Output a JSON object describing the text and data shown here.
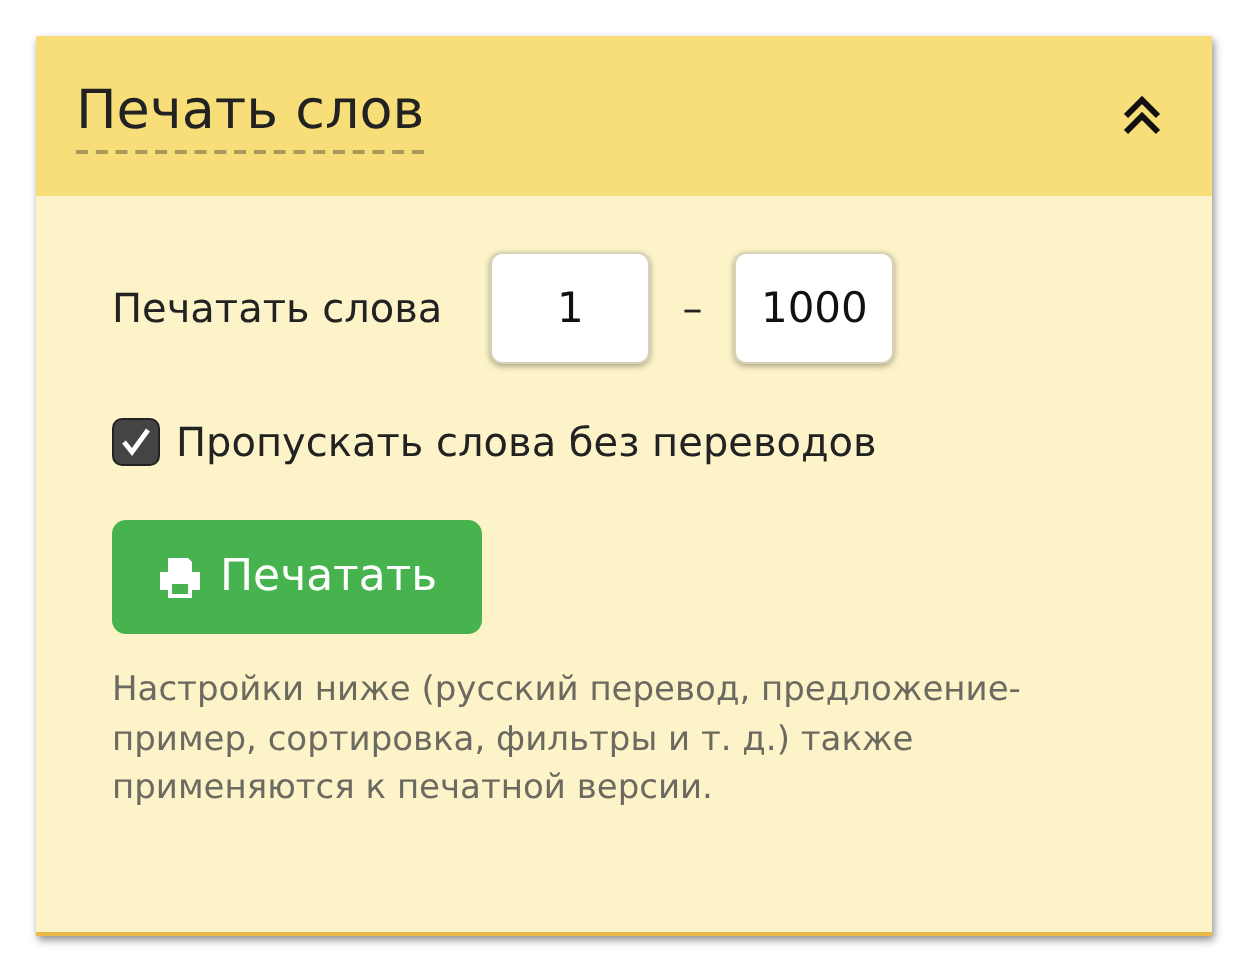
{
  "panel": {
    "title": "Печать слов",
    "expanded": true,
    "range": {
      "label": "Печатать слова",
      "from": "1",
      "separator": "–",
      "to": "1000"
    },
    "skip_untranslated": {
      "label": "Пропускать слова без переводов",
      "checked": true
    },
    "print_button": "Печатать",
    "note": "Настройки ниже (русский перевод, предложение-пример, сортировка, фильтры и т. д.) также применяются к печатной версии."
  }
}
